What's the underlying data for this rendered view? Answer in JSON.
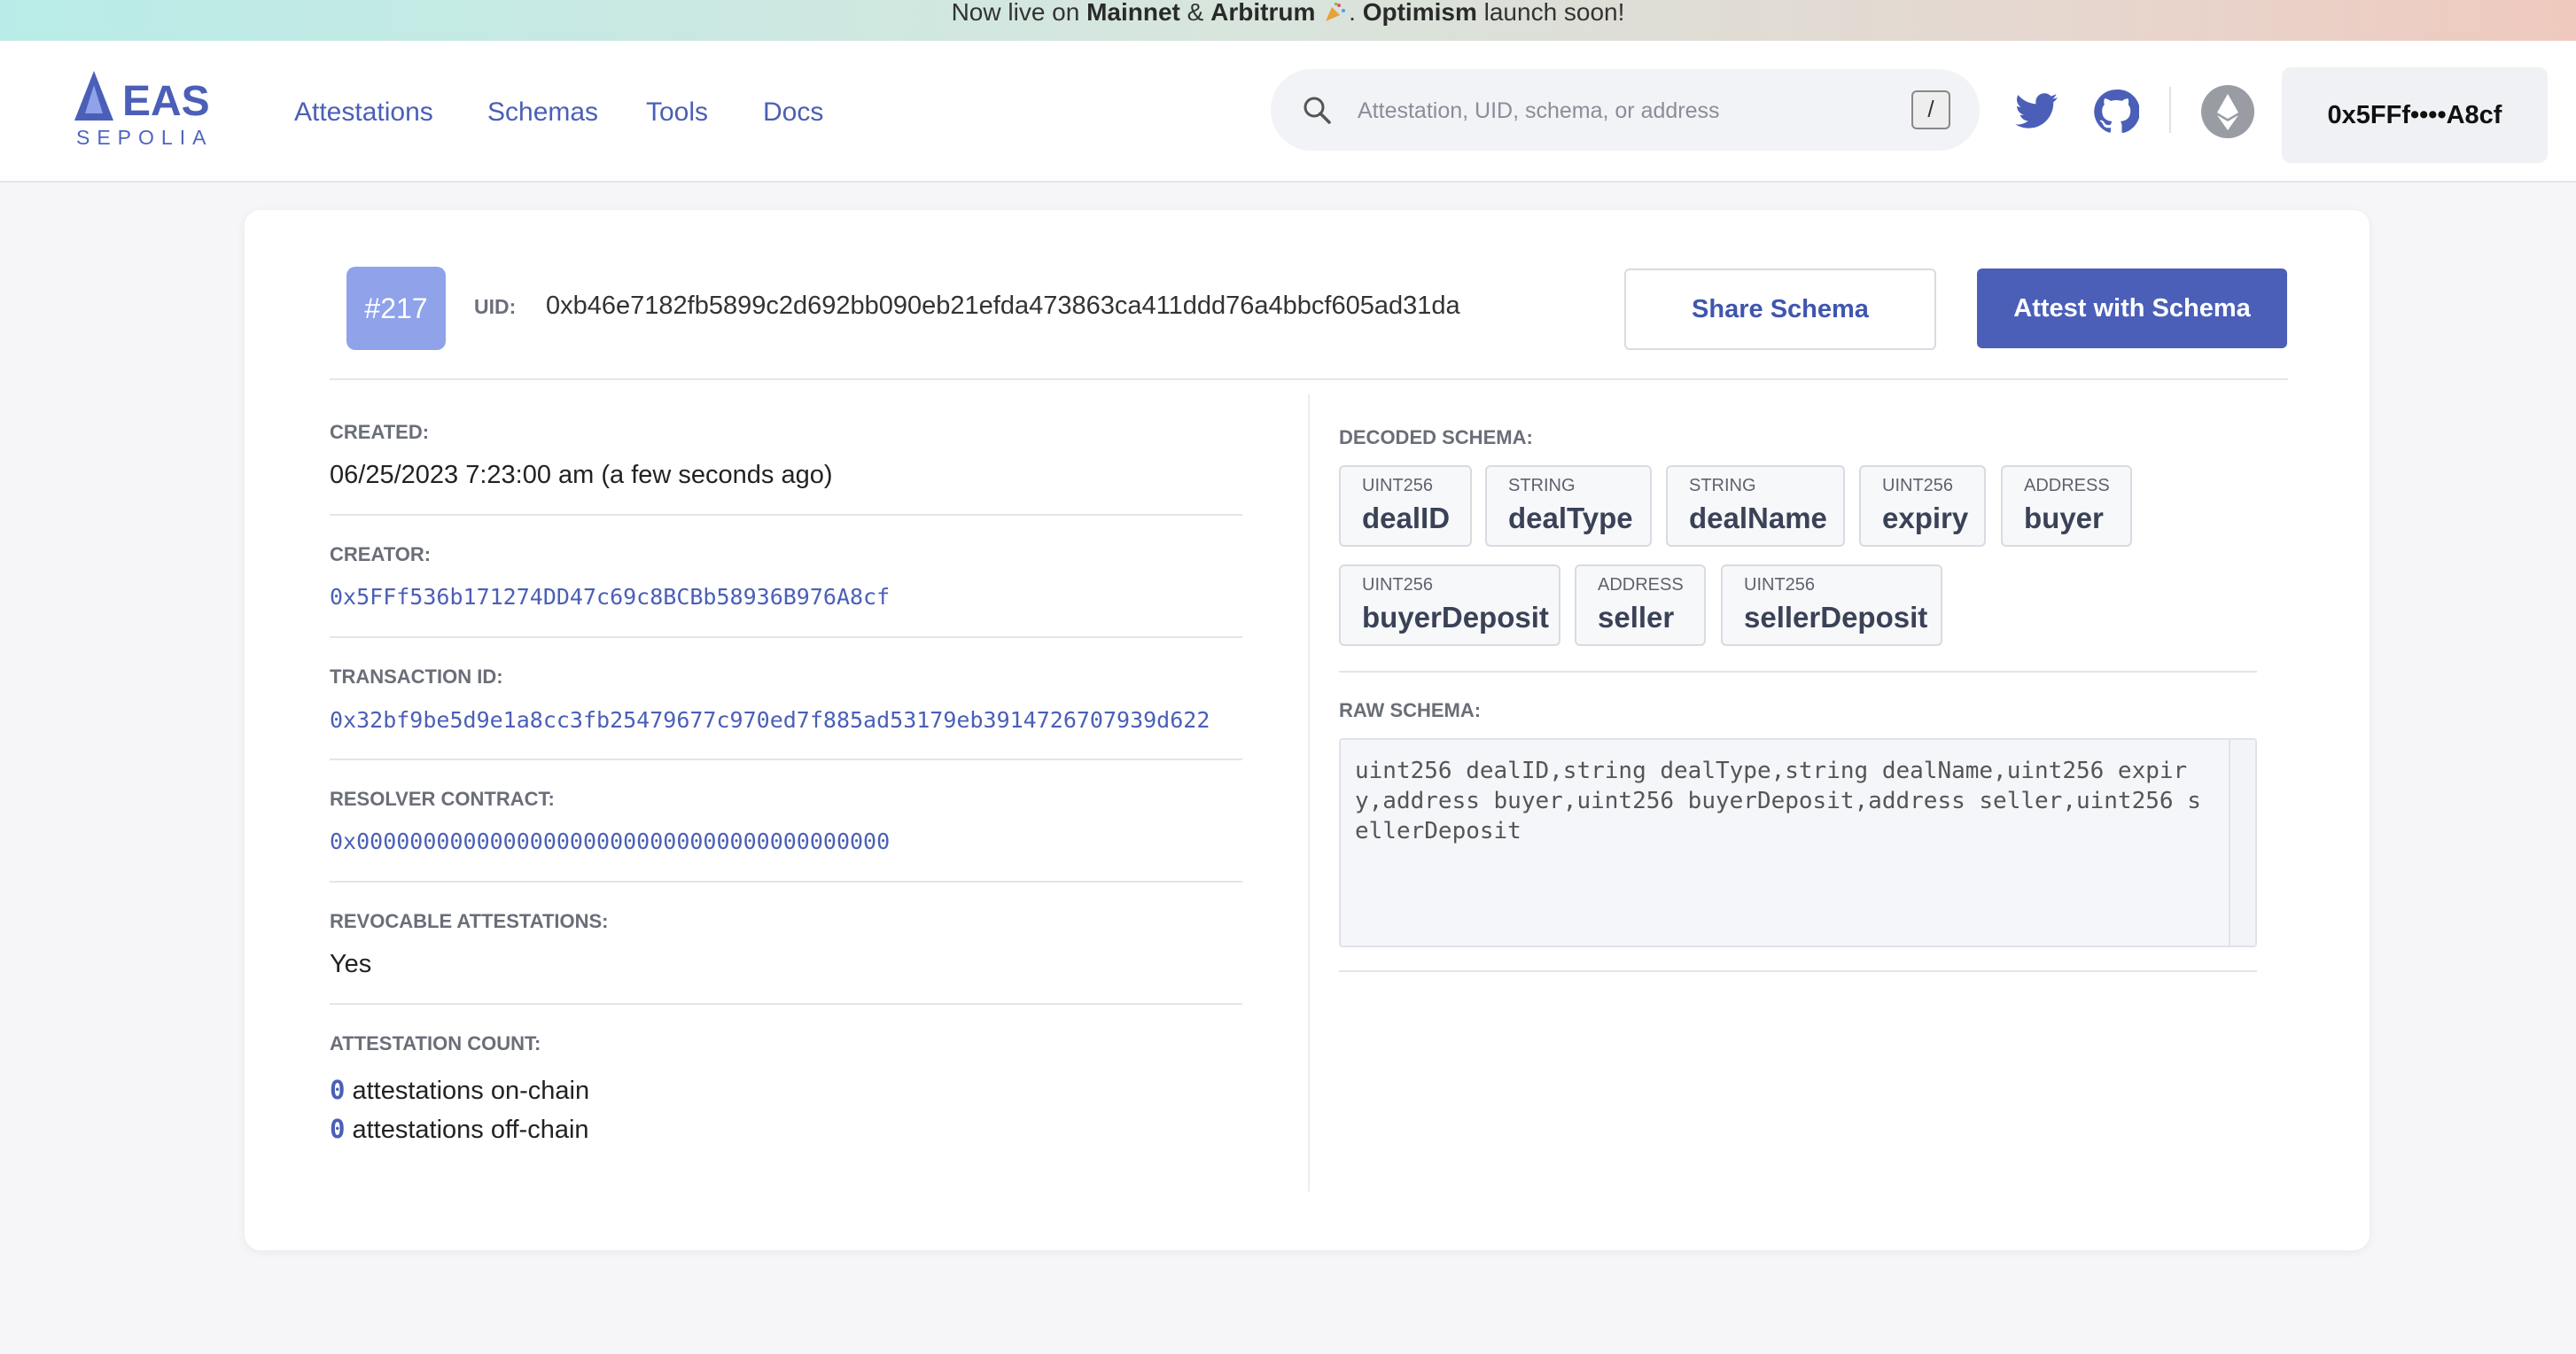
{
  "banner": {
    "prefix": "Now live on",
    "mainnet": "Mainnet",
    "amp": "&",
    "arbitrum": "Arbitrum",
    "dot": ".",
    "optimism": "Optimism",
    "suffix": "launch soon!"
  },
  "header": {
    "logo_text": "EAS",
    "network": "SEPOLIA",
    "nav": [
      "Attestations",
      "Schemas",
      "Tools",
      "Docs"
    ],
    "search_placeholder": "Attestation, UID, schema, or address",
    "search_shortcut": "/",
    "wallet": "0x5FFf••••A8cf"
  },
  "schema": {
    "number": "#217",
    "uid_label": "UID:",
    "uid": "0xb46e7182fb5899c2d692bb090eb21efda473863ca411ddd76a4bbcf605ad31da",
    "share_label": "Share Schema",
    "attest_label": "Attest with Schema",
    "created_label": "CREATED:",
    "created": "06/25/2023 7:23:00 am (a few seconds ago)",
    "creator_label": "CREATOR:",
    "creator": "0x5FFf536b171274DD47c69c8BCBb58936B976A8cf",
    "tx_label": "TRANSACTION ID:",
    "tx": "0x32bf9be5d9e1a8cc3fb25479677c970ed7f885ad53179eb3914726707939d622",
    "resolver_label": "RESOLVER CONTRACT:",
    "resolver": "0x0000000000000000000000000000000000000000",
    "revocable_label": "REVOCABLE ATTESTATIONS:",
    "revocable": "Yes",
    "count_label": "ATTESTATION COUNT:",
    "onchain_count": "0",
    "onchain_text": "attestations on-chain",
    "offchain_count": "0",
    "offchain_text": "attestations off-chain",
    "decoded_label": "DECODED SCHEMA:",
    "fields": [
      {
        "type": "UINT256",
        "name": "dealID"
      },
      {
        "type": "STRING",
        "name": "dealType"
      },
      {
        "type": "STRING",
        "name": "dealName"
      },
      {
        "type": "UINT256",
        "name": "expiry"
      },
      {
        "type": "ADDRESS",
        "name": "buyer"
      },
      {
        "type": "UINT256",
        "name": "buyerDeposit"
      },
      {
        "type": "ADDRESS",
        "name": "seller"
      },
      {
        "type": "UINT256",
        "name": "sellerDeposit"
      }
    ],
    "raw_label": "RAW SCHEMA:",
    "raw": "uint256 dealID,string dealType,string dealName,uint256 expiry,address buyer,uint256 buyerDeposit,address seller,uint256 sellerDeposit"
  },
  "colors": {
    "accent": "#4b5fb8",
    "badge": "#8fa2ea",
    "link": "#4a5fb7"
  },
  "icons": [
    "search-icon",
    "twitter-icon",
    "github-icon",
    "ethereum-icon",
    "party-popper-icon"
  ]
}
